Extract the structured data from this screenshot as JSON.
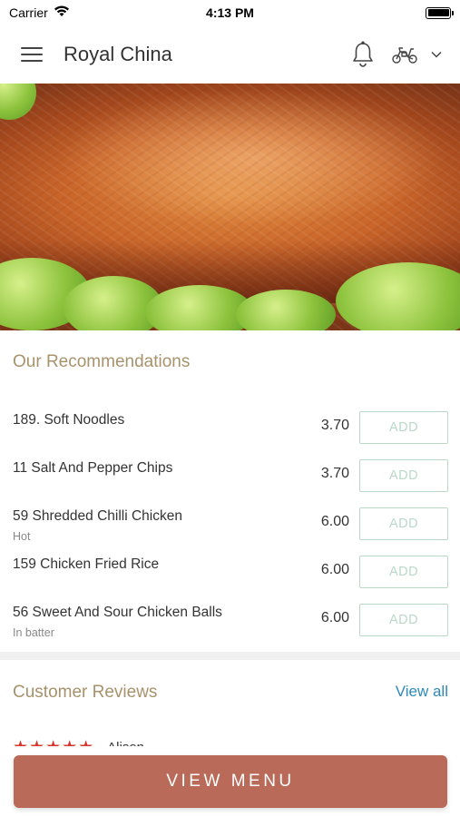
{
  "status_bar": {
    "carrier": "Carrier",
    "time": "4:13 PM"
  },
  "header": {
    "title": "Royal China"
  },
  "recommendations": {
    "title": "Our Recommendations",
    "add_label": "ADD",
    "items": [
      {
        "name": "189. Soft Noodles",
        "sub": "",
        "price": "3.70"
      },
      {
        "name": "11 Salt And Pepper Chips",
        "sub": "",
        "price": "3.70"
      },
      {
        "name": "59 Shredded Chilli Chicken",
        "sub": "Hot",
        "price": "6.00"
      },
      {
        "name": "159 Chicken Fried Rice",
        "sub": "",
        "price": "6.00"
      },
      {
        "name": "56 Sweet And Sour Chicken Balls",
        "sub": "In batter",
        "price": "6.00"
      }
    ]
  },
  "reviews": {
    "title": "Customer Reviews",
    "view_all": "View all",
    "first_reviewer": "Alison",
    "first_rating": 5,
    "stars": "★★★★★"
  },
  "cta": {
    "label": "VIEW MENU"
  },
  "colors": {
    "section_title": "#a8926b",
    "add_button": "#b9d9c6",
    "link": "#2e8ab8",
    "cta_background": "#b96a58",
    "stars": "#d6352b"
  }
}
